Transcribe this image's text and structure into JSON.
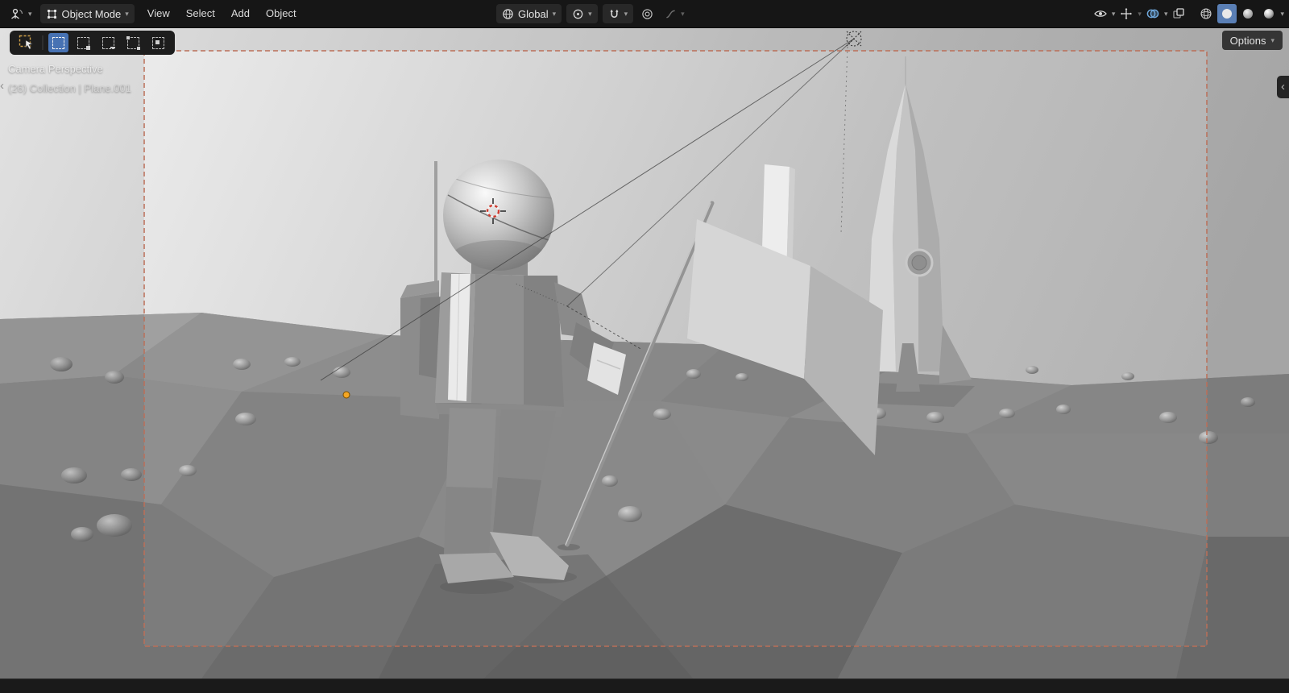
{
  "header": {
    "mode": "Object Mode",
    "menus": [
      "View",
      "Select",
      "Add",
      "Object"
    ],
    "orientation": "Global"
  },
  "tool_header": {
    "options_label": "Options"
  },
  "viewport_overlay": {
    "view_label": "Camera Perspective",
    "collection_label": "(26) Collection | Plane.001"
  },
  "icons": {
    "chevron_down": "▾",
    "panel_toggle_left": "‹",
    "panel_toggle_right": "‹"
  },
  "colors": {
    "accent_blue": "#4772b3",
    "camera_border": "#bb6f58",
    "origin_orange": "#f5a623",
    "overlay_toggle_blue": "#6fa8dc"
  }
}
